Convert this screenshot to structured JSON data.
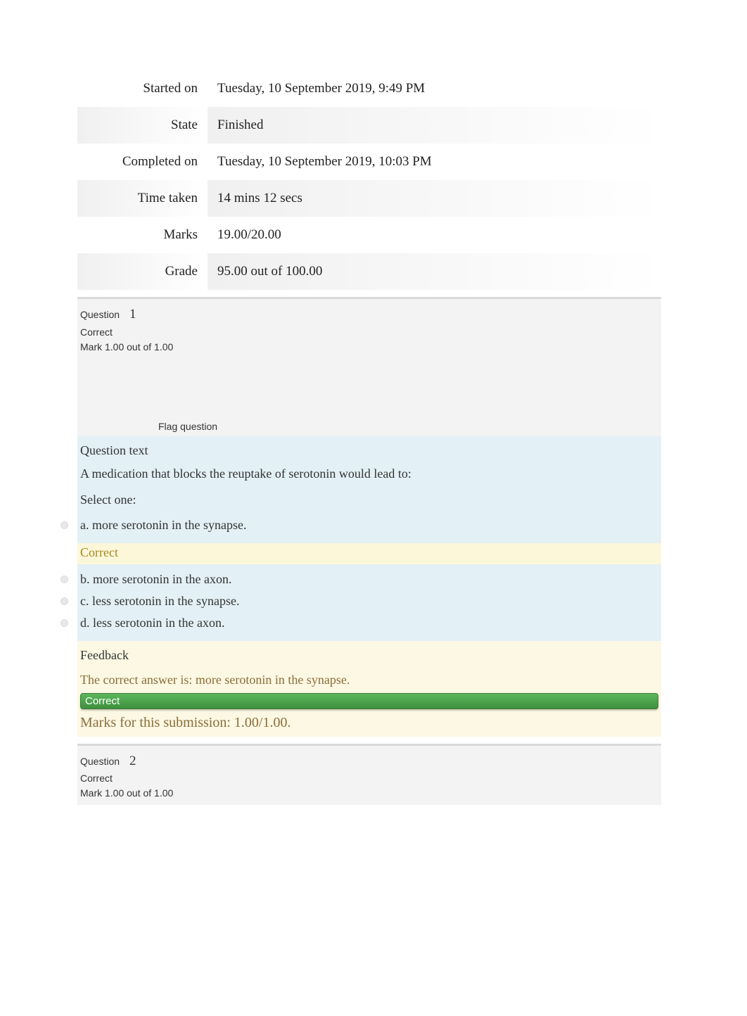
{
  "summary": {
    "rows": [
      {
        "label": "Started on",
        "value": "Tuesday, 10 September 2019, 9:49 PM"
      },
      {
        "label": "State",
        "value": "Finished"
      },
      {
        "label": "Completed on",
        "value": "Tuesday, 10 September 2019, 10:03 PM"
      },
      {
        "label": "Time taken",
        "value": "14 mins 12 secs"
      },
      {
        "label": "Marks",
        "value": "19.00/20.00"
      },
      {
        "label": "Grade",
        "value": "95.00  out of 100.00"
      }
    ]
  },
  "questions": [
    {
      "label": "Question",
      "number": "1",
      "status": "Correct",
      "mark_text": "Mark 1.00 out of 1.00",
      "flag_text": "Flag question",
      "section_title": "Question text",
      "prompt": "A medication that blocks the reuptake of serotonin would lead to:",
      "select_one": "Select one:",
      "options": [
        {
          "letter": "a.",
          "text": "more serotonin in the synapse.",
          "selected": true
        },
        {
          "letter": "b.",
          "text": "more serotonin in the axon.",
          "selected": false
        },
        {
          "letter": "c.",
          "text": "less serotonin in the synapse.",
          "selected": false
        },
        {
          "letter": "d.",
          "text": "less serotonin in the axon.",
          "selected": false
        }
      ],
      "correct_tag": "Correct",
      "feedback_title": "Feedback",
      "feedback_text": "The correct answer is: more serotonin in the synapse.",
      "correct_bar": "Correct",
      "marks_submission": "Marks for this submission: 1.00/1.00."
    },
    {
      "label": "Question",
      "number": "2",
      "status": "Correct",
      "mark_text": "Mark 1.00 out of 1.00"
    }
  ]
}
